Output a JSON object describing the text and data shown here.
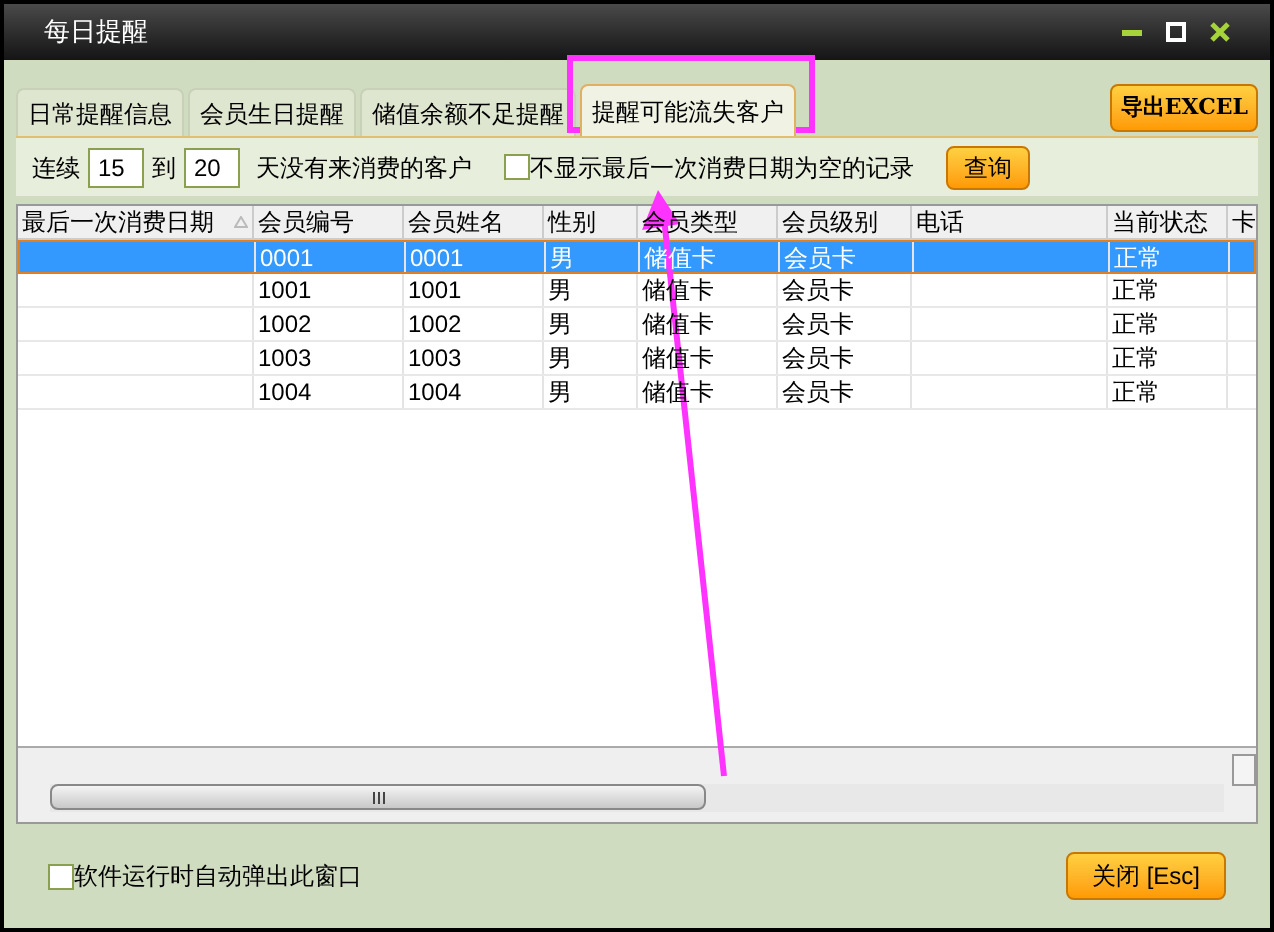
{
  "window": {
    "title": "每日提醒"
  },
  "tabs": [
    {
      "label": "日常提醒信息",
      "selected": false
    },
    {
      "label": "会员生日提醒",
      "selected": false
    },
    {
      "label": "储值余额不足提醒",
      "selected": false
    },
    {
      "label": "提醒可能流失客户",
      "selected": true
    }
  ],
  "export_button": "导出EXCEL",
  "filter": {
    "prefix": "连续",
    "from": "15",
    "to_label": "到",
    "to": "20",
    "suffix": "天没有来消费的客户",
    "hide_empty": {
      "label": "不显示最后一次消费日期为空的记录",
      "checked": false
    },
    "query_button": "查询"
  },
  "table": {
    "columns": [
      "最后一次消费日期",
      "会员编号",
      "会员姓名",
      "性别",
      "会员类型",
      "会员级别",
      "电话",
      "当前状态",
      "卡"
    ],
    "rows": [
      {
        "cells": [
          "",
          "0001",
          "0001",
          "男",
          "储值卡",
          "会员卡",
          "",
          "正常",
          ""
        ],
        "selected": true
      },
      {
        "cells": [
          "",
          "1001",
          "1001",
          "男",
          "储值卡",
          "会员卡",
          "",
          "正常",
          ""
        ],
        "selected": false
      },
      {
        "cells": [
          "",
          "1002",
          "1002",
          "男",
          "储值卡",
          "会员卡",
          "",
          "正常",
          ""
        ],
        "selected": false
      },
      {
        "cells": [
          "",
          "1003",
          "1003",
          "男",
          "储值卡",
          "会员卡",
          "",
          "正常",
          ""
        ],
        "selected": false
      },
      {
        "cells": [
          "",
          "1004",
          "1004",
          "男",
          "储值卡",
          "会员卡",
          "",
          "正常",
          ""
        ],
        "selected": false
      }
    ]
  },
  "auto_popup": {
    "label": "软件运行时自动弹出此窗口",
    "checked": false
  },
  "close_button": "关闭 [Esc]"
}
